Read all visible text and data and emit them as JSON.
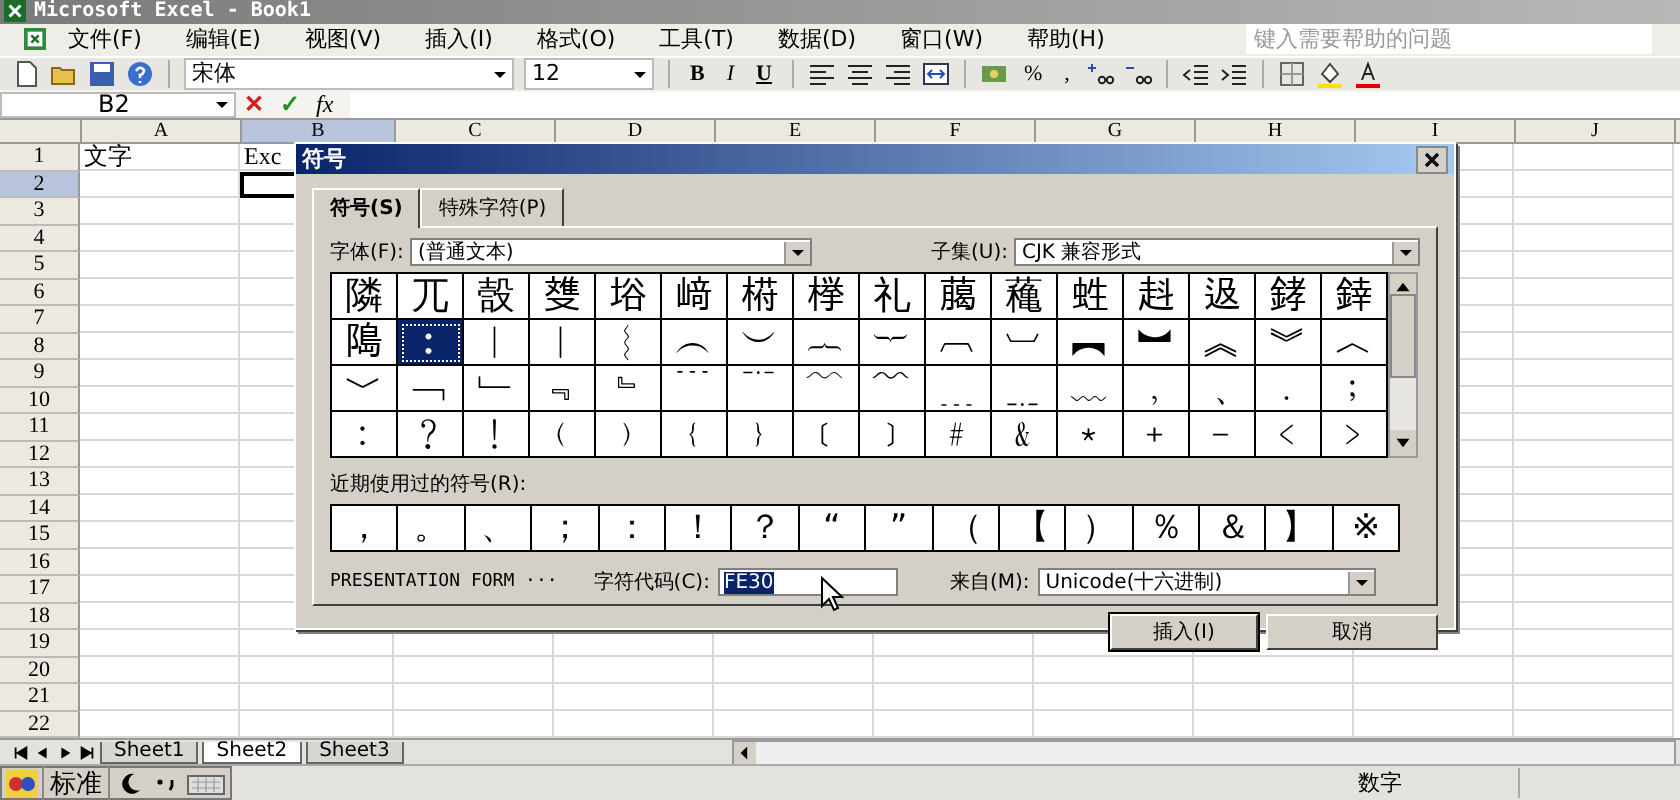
{
  "window": {
    "title": "Microsoft Excel - Book1"
  },
  "menu": [
    {
      "label": "文件(F)"
    },
    {
      "label": "编辑(E)"
    },
    {
      "label": "视图(V)"
    },
    {
      "label": "插入(I)"
    },
    {
      "label": "格式(O)"
    },
    {
      "label": "工具(T)"
    },
    {
      "label": "数据(D)"
    },
    {
      "label": "窗口(W)"
    },
    {
      "label": "帮助(H)"
    }
  ],
  "help_box": {
    "placeholder": "键入需要帮助的问题"
  },
  "toolbar": {
    "font": "宋体",
    "size": "12",
    "bold": "B",
    "italic": "I",
    "underline": "U",
    "percent": "%",
    "comma": ","
  },
  "formula_bar": {
    "name_box": "B2",
    "cancel": "✕",
    "enter": "✓",
    "function": "fx"
  },
  "sheet": {
    "columns": [
      {
        "label": "A",
        "selected": false
      },
      {
        "label": "B",
        "selected": true
      },
      {
        "label": "C",
        "selected": false
      },
      {
        "label": "D",
        "selected": false
      },
      {
        "label": "E",
        "selected": false
      },
      {
        "label": "F",
        "selected": false
      },
      {
        "label": "G",
        "selected": false
      },
      {
        "label": "H",
        "selected": false
      },
      {
        "label": "I",
        "selected": false
      },
      {
        "label": "J",
        "selected": false
      }
    ],
    "rows": [
      {
        "label": "1",
        "selected": false,
        "cells": [
          {
            "text": "文字",
            "selected": false
          },
          {
            "text": "Exc",
            "selected": false
          }
        ]
      },
      {
        "label": "2",
        "selected": true,
        "cells": [
          {
            "selected": false
          },
          {
            "selected": true
          }
        ]
      },
      {
        "label": "3",
        "selected": false
      },
      {
        "label": "4",
        "selected": false
      },
      {
        "label": "5",
        "selected": false
      },
      {
        "label": "6",
        "selected": false
      },
      {
        "label": "7",
        "selected": false
      },
      {
        "label": "8",
        "selected": false
      },
      {
        "label": "9",
        "selected": false
      },
      {
        "label": "10",
        "selected": false
      },
      {
        "label": "11",
        "selected": false
      },
      {
        "label": "12",
        "selected": false
      },
      {
        "label": "13",
        "selected": false
      },
      {
        "label": "14",
        "selected": false
      },
      {
        "label": "15",
        "selected": false
      },
      {
        "label": "16",
        "selected": false
      },
      {
        "label": "17",
        "selected": false
      },
      {
        "label": "18",
        "selected": false
      },
      {
        "label": "19",
        "selected": false
      },
      {
        "label": "20",
        "selected": false
      },
      {
        "label": "21",
        "selected": false
      },
      {
        "label": "22",
        "selected": false
      }
    ]
  },
  "sheet_tabs": [
    {
      "label": "Sheet1",
      "selected": false
    },
    {
      "label": "Sheet2",
      "selected": true
    },
    {
      "label": "Sheet3",
      "selected": false
    }
  ],
  "ime_bar": {
    "mode": "标准"
  },
  "status_bar": {
    "mode": "数字"
  },
  "dialog": {
    "title": "符号",
    "tabs": [
      {
        "label": "符号(S)",
        "selected": true
      },
      {
        "label": "特殊字符(P)",
        "selected": false
      }
    ],
    "font": {
      "label": "字体(F):",
      "value": "(普通文本)"
    },
    "subset": {
      "label": "子集(U):",
      "value": "CJK 兼容形式"
    },
    "grid": [
      [
        {
          "char": "隣",
          "selected": false
        },
        {
          "char": "兀",
          "selected": false
        },
        {
          "char": "嗀",
          "selected": false
        },
        {
          "char": "﨎",
          "selected": false
        },
        {
          "char": "﨏",
          "selected": false
        },
        {
          "char": "﨑",
          "selected": false
        },
        {
          "char": "﨓",
          "selected": false
        },
        {
          "char": "﨔",
          "selected": false
        },
        {
          "char": "礼",
          "selected": false
        },
        {
          "char": "﨟",
          "selected": false
        },
        {
          "char": "蘒",
          "selected": false
        },
        {
          "char": "﨡",
          "selected": false
        },
        {
          "char": "﨣",
          "selected": false
        },
        {
          "char": "﨤",
          "selected": false
        },
        {
          "char": "﨧",
          "selected": false
        },
        {
          "char": "﨨",
          "selected": false
        }
      ],
      [
        {
          "char": "﨩",
          "selected": false
        },
        {
          "char": "︰",
          "selected": true
        },
        {
          "char": "︱",
          "selected": false
        },
        {
          "char": "︳",
          "selected": false
        },
        {
          "char": "︴",
          "selected": false
        },
        {
          "char": "︵",
          "selected": false
        },
        {
          "char": "︶",
          "selected": false
        },
        {
          "char": "︷",
          "selected": false
        },
        {
          "char": "︸",
          "selected": false
        },
        {
          "char": "︹",
          "selected": false
        },
        {
          "char": "︺",
          "selected": false
        },
        {
          "char": "︻",
          "selected": false
        },
        {
          "char": "︼",
          "selected": false
        },
        {
          "char": "︽",
          "selected": false
        },
        {
          "char": "︾",
          "selected": false
        },
        {
          "char": "︿",
          "selected": false
        }
      ],
      [
        {
          "char": "﹀",
          "selected": false
        },
        {
          "char": "﹁",
          "selected": false
        },
        {
          "char": "﹂",
          "selected": false
        },
        {
          "char": "﹃",
          "selected": false
        },
        {
          "char": "﹄",
          "selected": false
        },
        {
          "char": "﹉",
          "selected": false
        },
        {
          "char": "﹊",
          "selected": false
        },
        {
          "char": "﹋",
          "selected": false
        },
        {
          "char": "﹌",
          "selected": false
        },
        {
          "char": "﹍",
          "selected": false
        },
        {
          "char": "﹎",
          "selected": false
        },
        {
          "char": "﹏",
          "selected": false
        },
        {
          "char": "﹐",
          "selected": false
        },
        {
          "char": "﹑",
          "selected": false
        },
        {
          "char": "﹒",
          "selected": false
        },
        {
          "char": "﹔",
          "selected": false
        }
      ],
      [
        {
          "char": "﹕",
          "selected": false
        },
        {
          "char": "﹖",
          "selected": false
        },
        {
          "char": "﹗",
          "selected": false
        },
        {
          "char": "﹙",
          "selected": false
        },
        {
          "char": "﹚",
          "selected": false
        },
        {
          "char": "﹛",
          "selected": false
        },
        {
          "char": "﹜",
          "selected": false
        },
        {
          "char": "﹝",
          "selected": false
        },
        {
          "char": "﹞",
          "selected": false
        },
        {
          "char": "﹟",
          "selected": false
        },
        {
          "char": "﹠",
          "selected": false
        },
        {
          "char": "﹡",
          "selected": false
        },
        {
          "char": "﹢",
          "selected": false
        },
        {
          "char": "﹣",
          "selected": false
        },
        {
          "char": "﹤",
          "selected": false
        },
        {
          "char": "﹥",
          "selected": false
        }
      ]
    ],
    "recent": {
      "label": "近期使用过的符号(R):",
      "symbols": [
        "，",
        "。",
        "、",
        "；",
        "：",
        "！",
        "？",
        "“",
        "”",
        "（",
        "【",
        "）",
        "％",
        "＆",
        "】",
        "※"
      ]
    },
    "description": "PRESENTATION FORM ···",
    "char_code": {
      "label": "字符代码(C):",
      "value": "FE30"
    },
    "from": {
      "label": "来自(M):",
      "value": "Unicode(十六进制)"
    },
    "buttons": [
      {
        "label": "插入(I)",
        "default": true
      },
      {
        "label": "取消",
        "default": false
      }
    ]
  }
}
